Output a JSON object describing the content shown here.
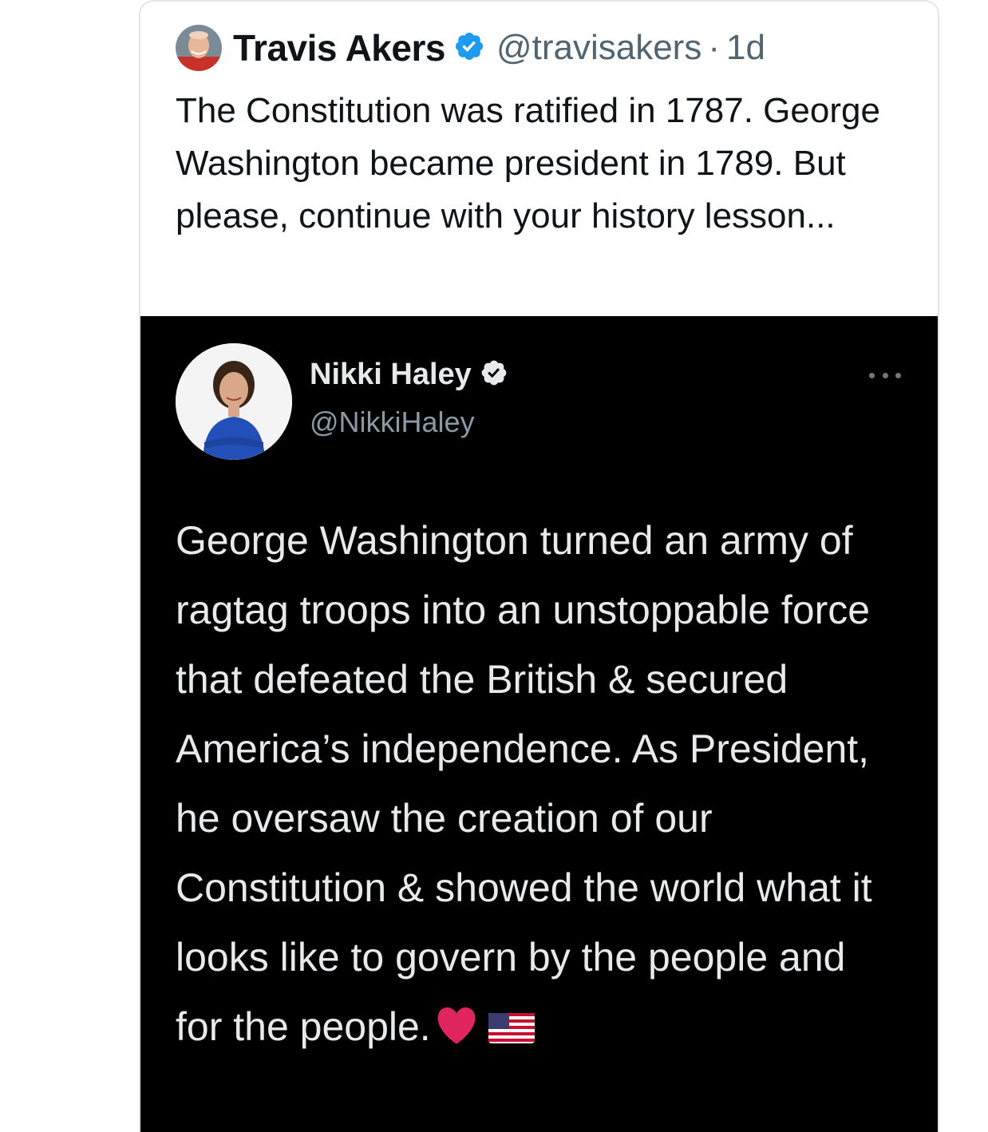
{
  "quote_tweet": {
    "display_name": "Travis Akers",
    "handle": "@travisakers",
    "separator": "·",
    "time": "1d",
    "text": "The Constitution was ratified in 1787. George Washington became president in 1789. But please, continue with your history lesson...",
    "avatar_icon": "profile-photo-man-icon",
    "verified_icon": "verified-badge-icon"
  },
  "embedded_tweet": {
    "display_name": "Nikki Haley",
    "handle": "@NikkiHaley",
    "text": "George Washington turned an army of ragtag troops into an unstoppable force that defeated the British & secured America’s independence. As President, he oversaw the creation of our Constitution & showed the world what it looks like to govern by the people and for the people.",
    "emoji": [
      "red-heart-icon",
      "us-flag-icon"
    ],
    "avatar_icon": "profile-photo-woman-icon",
    "verified_icon": "verified-badge-icon",
    "more_icon": "more-options-icon"
  },
  "colors": {
    "verified_blue": "#1d9bf0",
    "text_primary": "#0f1419",
    "text_secondary": "#536471",
    "embed_background": "#000000",
    "heart_red": "#e0245e"
  }
}
